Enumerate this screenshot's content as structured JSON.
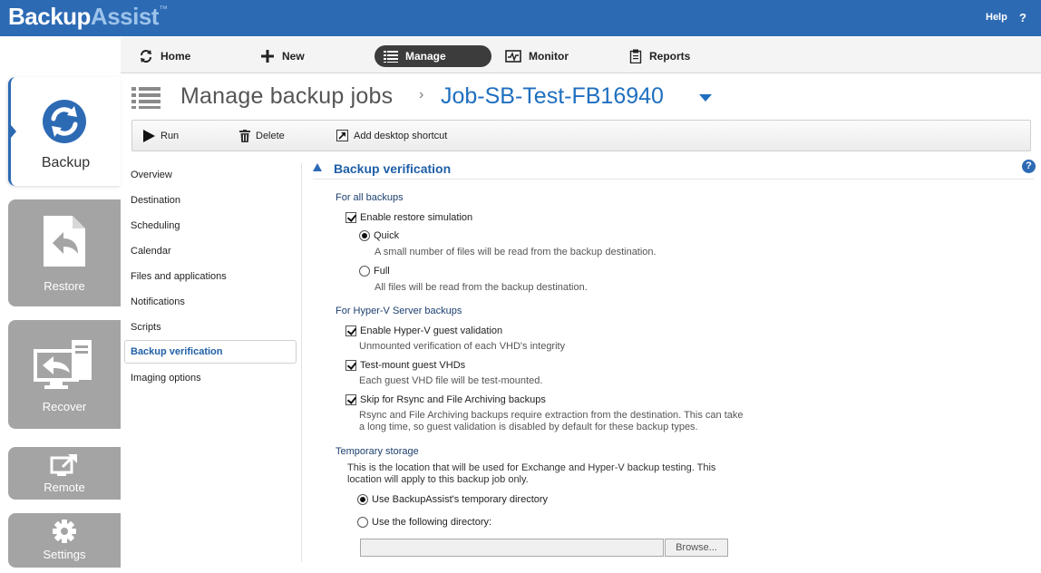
{
  "app": {
    "logo_part1": "Backup",
    "logo_part2": "Assist",
    "logo_tm": "™"
  },
  "topbar": {
    "help_label": "Help",
    "help_icon": "?"
  },
  "sidebar": {
    "tiles": [
      {
        "label": "Backup",
        "icon": "backup-sync-icon",
        "active": true
      },
      {
        "label": "Restore",
        "icon": "restore-icon",
        "active": false
      },
      {
        "label": "Recover",
        "icon": "recover-icon",
        "active": false
      },
      {
        "label": "Remote",
        "icon": "remote-icon",
        "active": false
      },
      {
        "label": "Settings",
        "icon": "gear-icon",
        "active": false
      }
    ]
  },
  "nav": {
    "items": [
      {
        "label": "Home",
        "icon": "refresh-icon"
      },
      {
        "label": "New",
        "icon": "plus-icon"
      },
      {
        "label": "Manage",
        "icon": "list-icon",
        "active": true
      },
      {
        "label": "Monitor",
        "icon": "monitor-icon"
      },
      {
        "label": "Reports",
        "icon": "clipboard-icon"
      }
    ]
  },
  "title": {
    "main": "Manage backup jobs",
    "separator": "›",
    "job": "Job-SB-Test-FB16940"
  },
  "toolbar": {
    "run_label": "Run",
    "delete_label": "Delete",
    "shortcut_label": "Add desktop shortcut"
  },
  "sidenav": {
    "items": [
      "Overview",
      "Destination",
      "Scheduling",
      "Calendar",
      "Files and applications",
      "Notifications",
      "Scripts",
      "Backup verification",
      "Imaging options"
    ],
    "active": "Backup verification"
  },
  "content": {
    "section_title": "Backup verification",
    "help_icon": "?",
    "all_backups": {
      "heading": "For all backups",
      "restore_sim_label": "Enable restore simulation",
      "restore_sim_checked": true,
      "quick_label": "Quick",
      "quick_desc": "A small number of files will be read from the backup destination.",
      "quick_selected": true,
      "full_label": "Full",
      "full_desc": "All files will be read from the backup destination.",
      "full_selected": false
    },
    "hyperv": {
      "heading": "For Hyper-V Server backups",
      "guest_validation_label": "Enable Hyper-V guest validation",
      "guest_validation_desc": "Unmounted verification of each VHD's integrity",
      "guest_validation_checked": true,
      "test_mount_label": "Test-mount guest VHDs",
      "test_mount_desc": "Each guest VHD file will be test-mounted.",
      "test_mount_checked": true,
      "skip_label": "Skip for Rsync and File Archiving backups",
      "skip_desc_1": "Rsync and File Archiving backups require extraction from the destination. This can take",
      "skip_desc_2": "a long time, so guest validation is disabled by default for these backup types.",
      "skip_checked": true
    },
    "temp_storage": {
      "heading": "Temporary storage",
      "desc_1": "This is the location that will be used for Exchange and Hyper-V backup testing. This",
      "desc_2": "location will apply to this backup job only.",
      "use_temp_label": "Use BackupAssist's temporary directory",
      "use_temp_selected": true,
      "use_following_label": "Use the following directory:",
      "use_following_selected": false,
      "directory_value": "",
      "browse_label": "Browse..."
    }
  }
}
